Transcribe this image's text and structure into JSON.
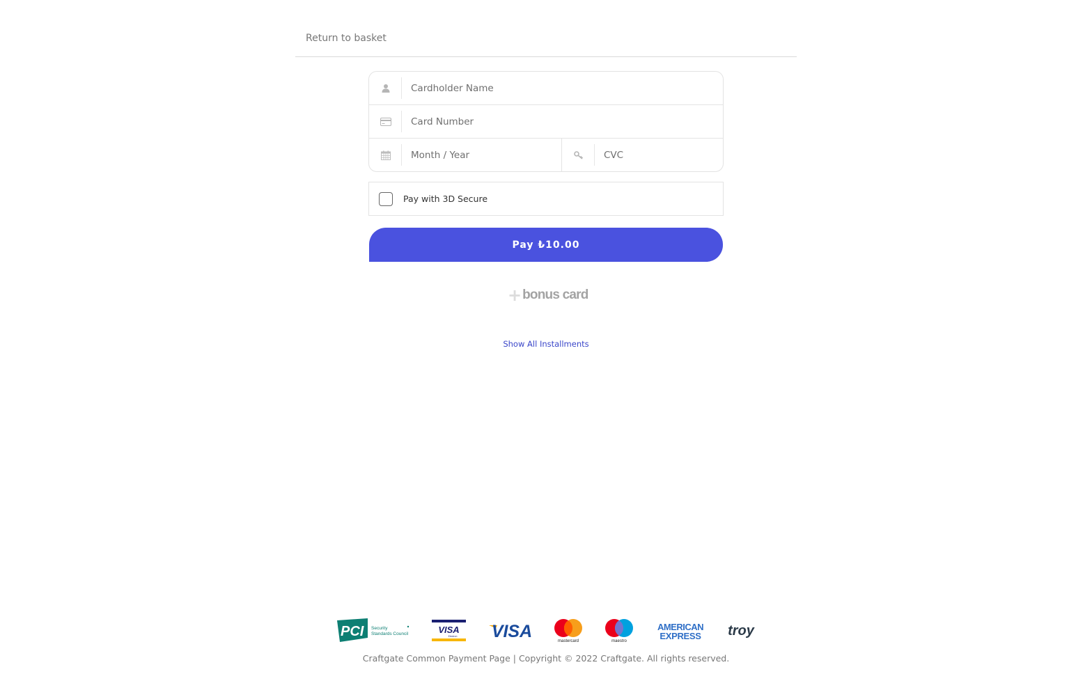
{
  "header": {
    "return_label": "Return to basket"
  },
  "form": {
    "cardholder_placeholder": "Cardholder Name",
    "card_number_placeholder": "Card Number",
    "expiry_placeholder": "Month / Year",
    "cvc_placeholder": "CVC",
    "icons": {
      "cardholder": "user-icon",
      "card_number": "credit-card-icon",
      "expiry": "calendar-icon",
      "cvc": "key-icon"
    }
  },
  "secure3d": {
    "label": "Pay with 3D Secure",
    "checked": false
  },
  "pay_button": {
    "label": "Pay ₺10.00",
    "color": "#4a52df"
  },
  "bonus": {
    "plus": "+",
    "text": "bonus card"
  },
  "installments_link": "Show All Installments",
  "logos": [
    {
      "name": "pci-dss-logo",
      "text": "PCI",
      "subtext": "Security Standards Council"
    },
    {
      "name": "visa-electron-logo",
      "text": "VISA",
      "subtext": "Electron"
    },
    {
      "name": "visa-logo",
      "text": "VISA"
    },
    {
      "name": "mastercard-logo",
      "text": "mastercard"
    },
    {
      "name": "maestro-logo",
      "text": "maestro"
    },
    {
      "name": "american-express-logo",
      "text": "AMERICAN",
      "subtext": "EXPRESS"
    },
    {
      "name": "troy-logo",
      "text": "troy"
    }
  ],
  "footer": {
    "text": "Craftgate Common Payment Page | Copyright © 2022 Craftgate. All rights reserved."
  }
}
